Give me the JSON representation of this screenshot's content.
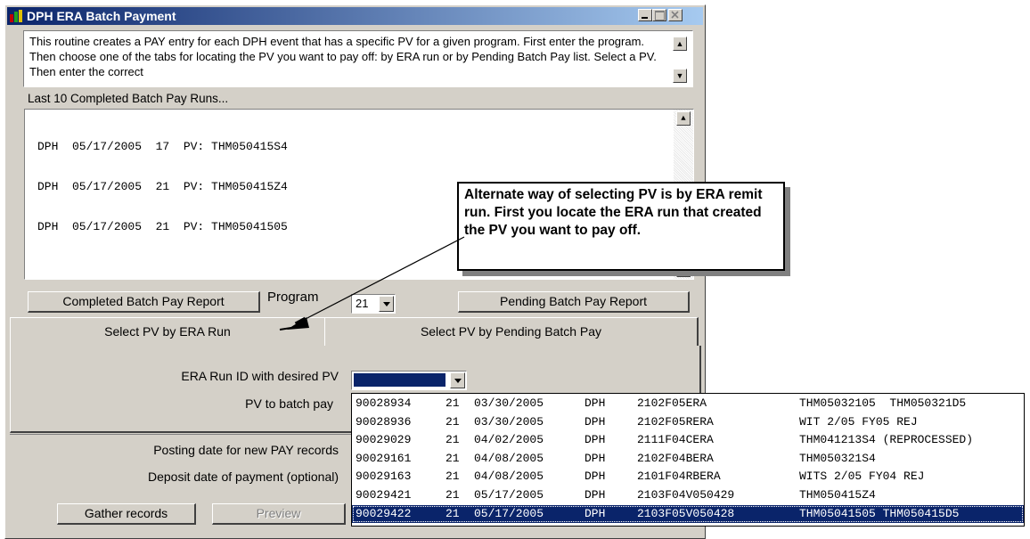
{
  "window": {
    "title": "DPH ERA Batch Payment",
    "description": "This routine creates a PAY entry for each DPH event that has a specific PV for a given program.  First enter the program.  Then choose one of the tabs for locating the PV you want to pay off: by ERA run or by Pending Batch Pay list. Select a PV. Then enter the correct"
  },
  "runs": {
    "label": "Last 10 Completed Batch Pay Runs...",
    "items": [
      "DPH  05/17/2005  17  PV: THM050415S4",
      "DPH  05/17/2005  21  PV: THM050415Z4",
      "DPH  05/17/2005  21  PV: THM05041505"
    ]
  },
  "controls": {
    "completed_report": "Completed Batch Pay Report",
    "program_label": "Program",
    "program_value": "21",
    "pending_report": "Pending Batch Pay Report"
  },
  "tabs": {
    "era": "Select PV by ERA Run",
    "pending": "Select PV by Pending Batch Pay"
  },
  "form": {
    "era_run_label": "ERA Run ID with desired PV",
    "pv_label": "PV to batch pay",
    "posting_label": "Posting date for new PAY records",
    "deposit_label": "Deposit date of payment (optional)",
    "gather_button": "Gather records",
    "preview_button": "Preview"
  },
  "callout": "Alternate way of selecting PV is by ERA remit run.   First you locate the ERA run that created the PV you want to pay off.",
  "dropdown": {
    "rows": [
      {
        "id": "90028934",
        "prog": "21",
        "date": "03/30/2005",
        "agency": "DPH",
        "file": "2102F05ERA",
        "pv": "THM05032105  THM050321D5"
      },
      {
        "id": "90028936",
        "prog": "21",
        "date": "03/30/2005",
        "agency": "DPH",
        "file": "2102F05RERA",
        "pv": "WIT 2/05 FY05 REJ"
      },
      {
        "id": "90029029",
        "prog": "21",
        "date": "04/02/2005",
        "agency": "DPH",
        "file": "2111F04CERA",
        "pv": "THM041213S4 (REPROCESSED)"
      },
      {
        "id": "90029161",
        "prog": "21",
        "date": "04/08/2005",
        "agency": "DPH",
        "file": "2102F04BERA",
        "pv": "THM050321S4"
      },
      {
        "id": "90029163",
        "prog": "21",
        "date": "04/08/2005",
        "agency": "DPH",
        "file": "2101F04RBERA",
        "pv": "WITS 2/05 FY04 REJ"
      },
      {
        "id": "90029421",
        "prog": "21",
        "date": "05/17/2005",
        "agency": "DPH",
        "file": "2103F04V050429",
        "pv": "THM050415Z4"
      },
      {
        "id": "90029422",
        "prog": "21",
        "date": "05/17/2005",
        "agency": "DPH",
        "file": "2103F05V050428",
        "pv": "THM05041505 THM050415D5"
      }
    ],
    "selected_index": 6
  },
  "colors": {
    "titlebar": "#0a246a",
    "selection": "#0a246a",
    "face": "#d4d0c8"
  }
}
